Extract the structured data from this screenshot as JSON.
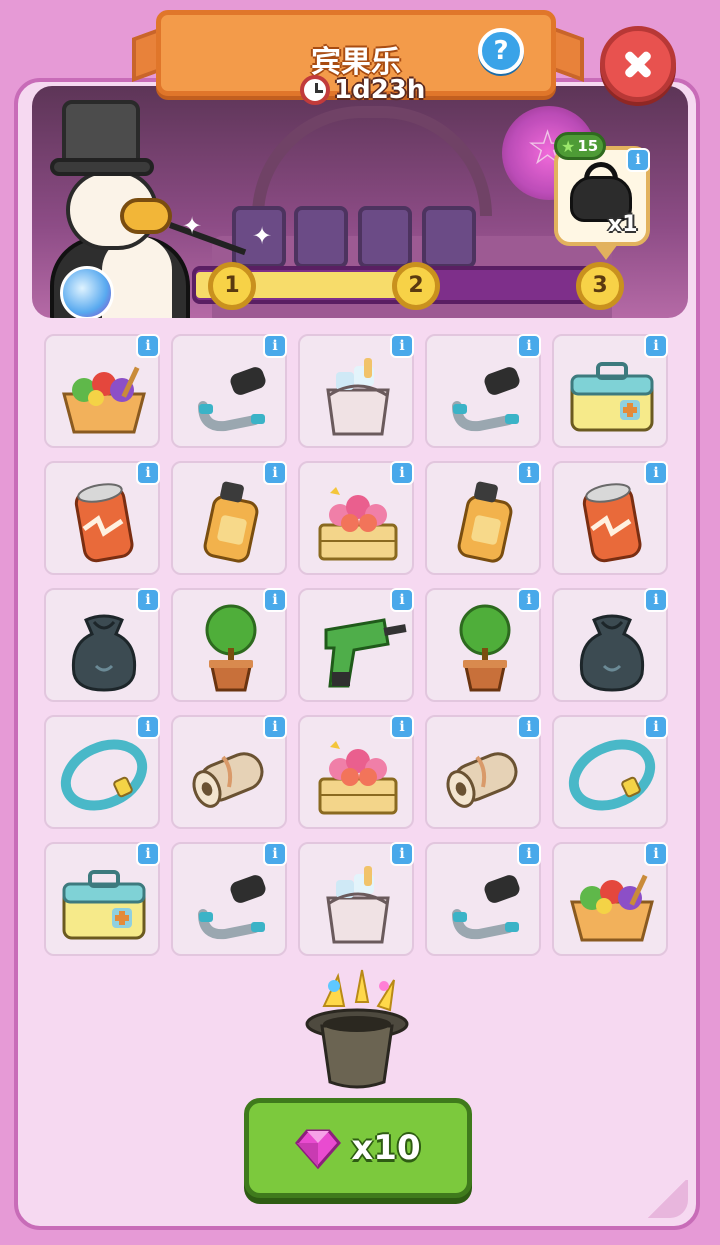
{
  "header": {
    "title": "宾果乐",
    "timer": "1d23h",
    "help_label": "?"
  },
  "reward": {
    "stars": "15",
    "count": "x1",
    "icon": "black-handbag-icon"
  },
  "progress": {
    "fill_fraction": 0.5,
    "milestones": [
      "1",
      "2",
      "3"
    ]
  },
  "grid": {
    "info_label": "i",
    "rows": [
      [
        "salad-box-icon",
        "hose-nozzle-icon",
        "ice-bucket-icon",
        "hose-nozzle-icon",
        "first-aid-kit-icon"
      ],
      [
        "soda-can-icon",
        "oil-bottle-icon",
        "flower-crate-icon",
        "oil-bottle-icon",
        "soda-can-icon"
      ],
      [
        "trash-bag-icon",
        "potted-plant-icon",
        "power-drill-icon",
        "potted-plant-icon",
        "trash-bag-icon"
      ],
      [
        "ring-hoop-icon",
        "paper-roll-icon",
        "flower-crate-icon",
        "paper-roll-icon",
        "ring-hoop-icon"
      ],
      [
        "first-aid-kit-icon",
        "hose-nozzle-icon",
        "ice-bucket-icon",
        "hose-nozzle-icon",
        "salad-box-icon"
      ]
    ]
  },
  "cta": {
    "label": "x10",
    "icon": "pink-gem-icon"
  },
  "colors": {
    "background": "#e69ad6",
    "banner": "#f39b4a",
    "cta": "#7cc93d",
    "progress_fill": "#f7dc6a"
  }
}
